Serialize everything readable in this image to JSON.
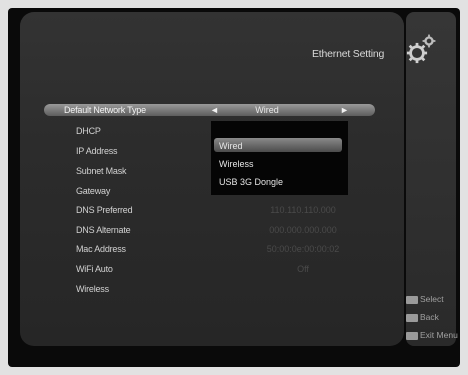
{
  "screen": {
    "title": "Ethernet Setting",
    "selected_row": {
      "label": "Default Network Type",
      "value": "Wired",
      "left_arrow": "◄",
      "right_arrow": "►"
    },
    "rows": [
      {
        "label": "DHCP",
        "value": ""
      },
      {
        "label": "IP Address",
        "value": ""
      },
      {
        "label": "Subnet Mask",
        "value": ""
      },
      {
        "label": "Gateway",
        "value": ""
      },
      {
        "label": "DNS Preferred",
        "value": "110.110.110.000"
      },
      {
        "label": "DNS Alternate",
        "value": "000.000.000.000"
      },
      {
        "label": "Mac Address",
        "value": "50:00:0e:00:00:02"
      },
      {
        "label": "WiFi Auto",
        "value": "Off"
      },
      {
        "label": "Wireless",
        "value": ""
      }
    ],
    "dropdown": {
      "options": [
        "Wired",
        "Wireless",
        "USB 3G Dongle"
      ],
      "highlighted": "Wired"
    }
  },
  "legend": {
    "items": [
      {
        "key": "ok-key-icon",
        "label": "Select"
      },
      {
        "key": "back-key-icon",
        "label": "Back"
      },
      {
        "key": "exit-key-icon",
        "label": "Exit Menu"
      }
    ]
  }
}
